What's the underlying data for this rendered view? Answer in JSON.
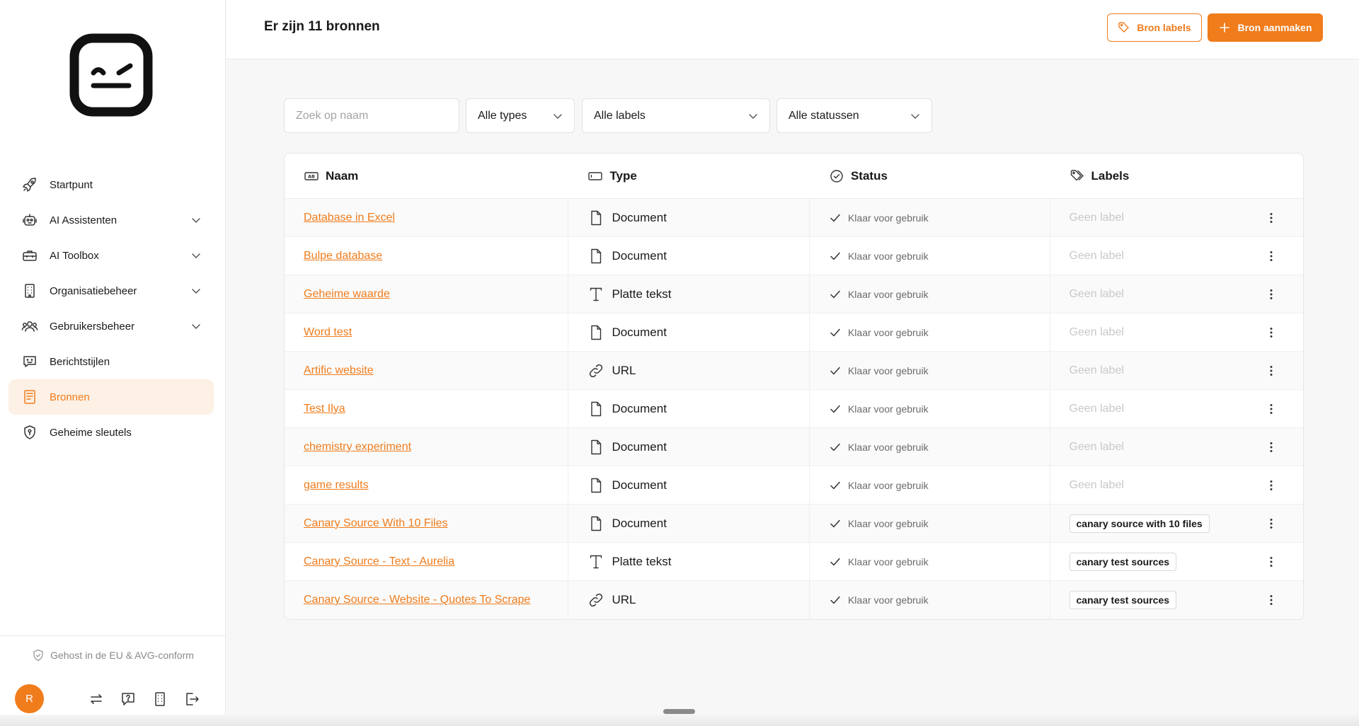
{
  "colors": {
    "accent": "#f07c1c",
    "active_bg": "#fdf0e4"
  },
  "sidebar": {
    "items": [
      {
        "label": "Startpunt",
        "icon": "rocket-icon",
        "has_chevron": false,
        "active": false
      },
      {
        "label": "AI Assistenten",
        "icon": "robot-icon",
        "has_chevron": true,
        "active": false
      },
      {
        "label": "AI Toolbox",
        "icon": "toolbox-icon",
        "has_chevron": true,
        "active": false
      },
      {
        "label": "Organisatiebeheer",
        "icon": "building-icon",
        "has_chevron": true,
        "active": false
      },
      {
        "label": "Gebruikersbeheer",
        "icon": "users-icon",
        "has_chevron": true,
        "active": false
      },
      {
        "label": "Berichtstijlen",
        "icon": "message-smile-icon",
        "has_chevron": false,
        "active": false
      },
      {
        "label": "Bronnen",
        "icon": "book-icon",
        "has_chevron": false,
        "active": true
      },
      {
        "label": "Geheime sleutels",
        "icon": "shield-key-icon",
        "has_chevron": false,
        "active": false
      }
    ],
    "hosted_text": "Gehost in de EU & AVG-conform",
    "avatar_initial": "R"
  },
  "header": {
    "title": "Er zijn 11 bronnen",
    "labels_button": "Bron labels",
    "create_button": "Bron aanmaken"
  },
  "filters": {
    "search_placeholder": "Zoek op naam",
    "types": "Alle types",
    "labels": "Alle labels",
    "statuses": "Alle statussen"
  },
  "table": {
    "columns": {
      "name": "Naam",
      "type": "Type",
      "status": "Status",
      "labels": "Labels"
    },
    "no_label_text": "Geen label",
    "rows": [
      {
        "name": "Database in Excel",
        "type": "Document",
        "type_icon": "document-icon",
        "status": "Klaar voor gebruik",
        "label": ""
      },
      {
        "name": "Bulpe database",
        "type": "Document",
        "type_icon": "document-icon",
        "status": "Klaar voor gebruik",
        "label": ""
      },
      {
        "name": "Geheime waarde",
        "type": "Platte tekst",
        "type_icon": "text-icon",
        "status": "Klaar voor gebruik",
        "label": ""
      },
      {
        "name": "Word test",
        "type": "Document",
        "type_icon": "document-icon",
        "status": "Klaar voor gebruik",
        "label": ""
      },
      {
        "name": "Artific website",
        "type": "URL",
        "type_icon": "link-icon",
        "status": "Klaar voor gebruik",
        "label": ""
      },
      {
        "name": "Test Ilya",
        "type": "Document",
        "type_icon": "document-icon",
        "status": "Klaar voor gebruik",
        "label": ""
      },
      {
        "name": "chemistry experiment",
        "type": "Document",
        "type_icon": "document-icon",
        "status": "Klaar voor gebruik",
        "label": ""
      },
      {
        "name": "game results",
        "type": "Document",
        "type_icon": "document-icon",
        "status": "Klaar voor gebruik",
        "label": ""
      },
      {
        "name": "Canary Source With 10 Files",
        "type": "Document",
        "type_icon": "document-icon",
        "status": "Klaar voor gebruik",
        "label": "canary source with 10 files"
      },
      {
        "name": "Canary Source - Text - Aurelia",
        "type": "Platte tekst",
        "type_icon": "text-icon",
        "status": "Klaar voor gebruik",
        "label": "canary test sources"
      },
      {
        "name": "Canary Source - Website - Quotes To Scrape",
        "type": "URL",
        "type_icon": "link-icon",
        "status": "Klaar voor gebruik",
        "label": "canary test sources"
      }
    ]
  }
}
